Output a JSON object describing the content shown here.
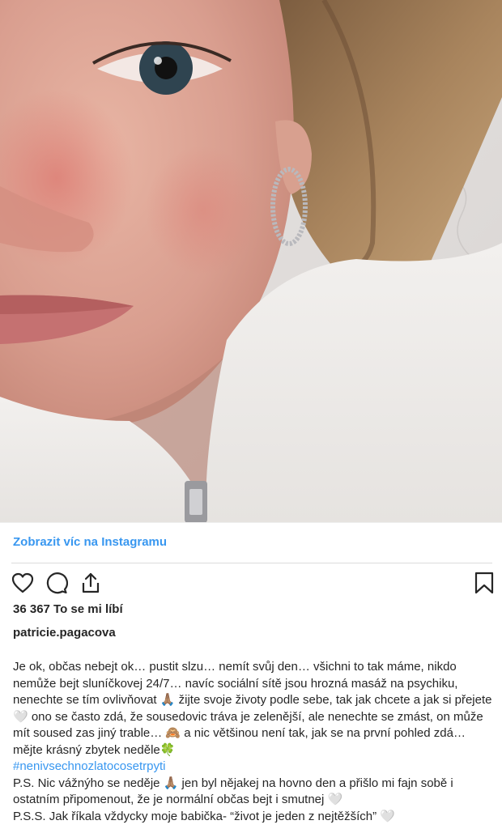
{
  "post": {
    "image_alt": "selfie",
    "view_more_label": "Zobrazit víc na Instagramu",
    "likes_text": "36 367 To se mi líbí",
    "username": "patricie.pagacova",
    "caption": {
      "paragraph_1": "Je ok, občas nebejt ok… pustit slzu… nemít svůj den… všichni to tak máme, nikdo nemůže bejt sluníčkovej 24/7… navíc sociální sítě jsou hrozná masáž na psychiku, nenechte se tím ovlivňovat 🙏🏽 žijte svoje životy podle sebe, tak jak chcete a jak si přejete 🤍 ono se často zdá, že sousedovic tráva je zelenější, ale nenechte se zmást, on může mít soused zas jiný trable… 🙈 a nic většinou není tak, jak se na první pohled zdá… mějte krásný zbytek neděle🍀",
      "hashtag": "#nenivsechnozlatocosetrpyti",
      "ps": "P.S. Nic vážnýho se neděje 🙏🏽 jen byl nějakej na hovno den a přišlo mi fajn sobě i ostatním připomenout, že je normální občas bejt i smutnej 🤍",
      "pss": "P.S.S. Jak říkala vždycky moje babička- “život je jeden z nejtěžších” 🤍"
    }
  },
  "icons": {
    "like": "heart-icon",
    "comment": "comment-icon",
    "share": "share-icon",
    "save": "bookmark-icon"
  }
}
